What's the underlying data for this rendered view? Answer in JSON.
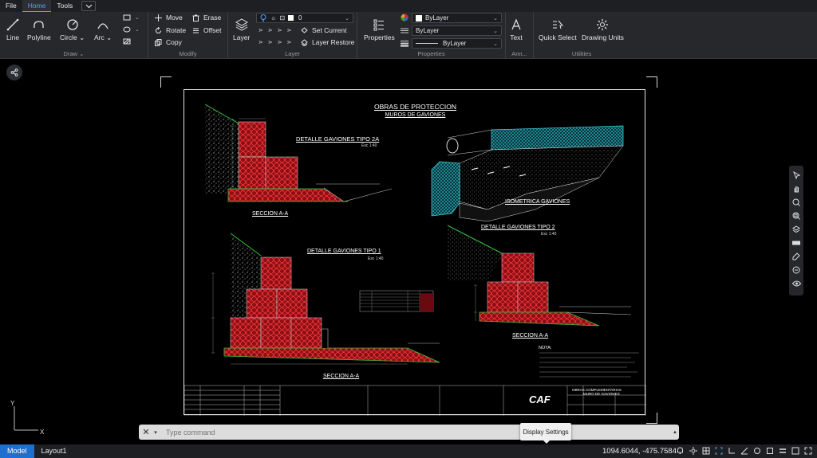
{
  "menubar": {
    "items": [
      "File",
      "Home",
      "Tools"
    ],
    "active": "Home"
  },
  "ribbon": {
    "draw": {
      "label": "Draw",
      "tools": [
        "Line",
        "Polyline",
        "Circle",
        "Arc"
      ]
    },
    "modify": {
      "label": "Modify",
      "move": "Move",
      "rotate": "Rotate",
      "copy": "Copy",
      "erase": "Erase",
      "offset": "Offset"
    },
    "layer": {
      "label": "Layer",
      "button": "Layer",
      "current_layer": "0",
      "set_current": "Set Current",
      "layer_restore": "Layer Restore"
    },
    "properties": {
      "label": "Properties",
      "button": "Properties",
      "color": "ByLayer",
      "linetype": "ByLayer",
      "lineweight": "ByLayer"
    },
    "annotation": {
      "label": "Ann...",
      "text": "Text"
    },
    "utilities": {
      "label": "Utilities",
      "quick_select": "Quick Select",
      "drawing_units": "Drawing Units"
    }
  },
  "drawing": {
    "title": "OBRAS DE PROTECCION",
    "subtitle": "MUROS DE GAVIONES",
    "detail_2a": "DETALLE GAVIONES TIPO 2A",
    "scale_2a": "Esc 1:40",
    "section_1": "SECCION A-A",
    "isometric": "ISOMETRICA GAVIONES",
    "detail_2": "DETALLE GAVIONES TIPO 2",
    "scale_2": "Esc 1:40",
    "detail_1": "DETALLE GAVIONES TIPO 1",
    "scale_1": "Esc 1:40",
    "section_2": "SECCION A-A",
    "section_3": "SECCION A-A",
    "title_block": "OBRAS COMPLEMENTARIAS",
    "title_block_sub": "MURO DE GAVIONES",
    "logo": "CAF",
    "notes_header": "NOTA:"
  },
  "command": {
    "placeholder": "Type command"
  },
  "tooltip": "Display Settings",
  "statusbar": {
    "tabs": [
      "Model",
      "Layout1"
    ],
    "active_tab": "Model",
    "coords": "1094.6044, -475.7584"
  },
  "ucs": {
    "x": "X",
    "y": "Y"
  },
  "colors": {
    "accent": "#1f6fcf",
    "gabion_fill": "#b3141c",
    "ground_green": "#39c23c",
    "sheet_frame": "#e6e6e6",
    "iso_cyan": "#3fd8e6"
  }
}
